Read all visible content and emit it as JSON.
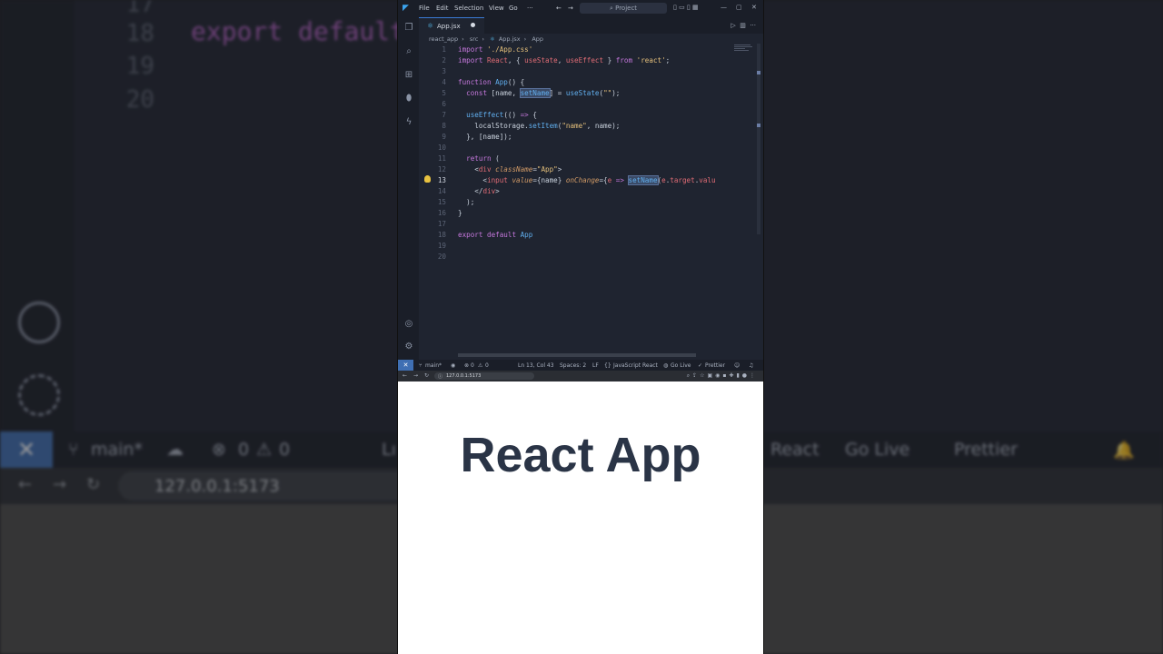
{
  "background": {
    "line_numbers": [
      "17",
      "18",
      "19",
      "20"
    ],
    "export_text": "export default",
    "status_branch": "main*",
    "status_errors": "0",
    "status_warnings": "0",
    "status_lang": "Lı",
    "status_react": "React",
    "status_golive": "Go Live",
    "status_prettier": "Prettier",
    "url": "127.0.0.1:5173"
  },
  "titlebar": {
    "menu": [
      "File",
      "Edit",
      "Selection",
      "View",
      "Go",
      "···"
    ],
    "search_placeholder": "Project"
  },
  "tab": {
    "label": "App.jsx"
  },
  "breadcrumb": [
    "react_app",
    "src",
    "App.jsx",
    "App"
  ],
  "editor": {
    "line_numbers": [
      "1",
      "2",
      "3",
      "4",
      "5",
      "6",
      "7",
      "8",
      "9",
      "10",
      "11",
      "12",
      "13",
      "14",
      "15",
      "16",
      "17",
      "18",
      "19",
      "20"
    ],
    "current_line": "13"
  },
  "statusbar": {
    "branch": "main*",
    "errors": "0",
    "warnings": "0",
    "position": "Ln 13, Col 43",
    "spaces": "Spaces: 2",
    "eol": "LF",
    "language": "JavaScript React",
    "golive": "Go Live",
    "prettier": "Prettier"
  },
  "browser": {
    "url": "127.0.0.1:5173",
    "heading": "React App"
  },
  "colors": {
    "keyword": "#c678dd",
    "string": "#e5c07b",
    "function": "#61afef",
    "accent": "#3f6fb3"
  }
}
